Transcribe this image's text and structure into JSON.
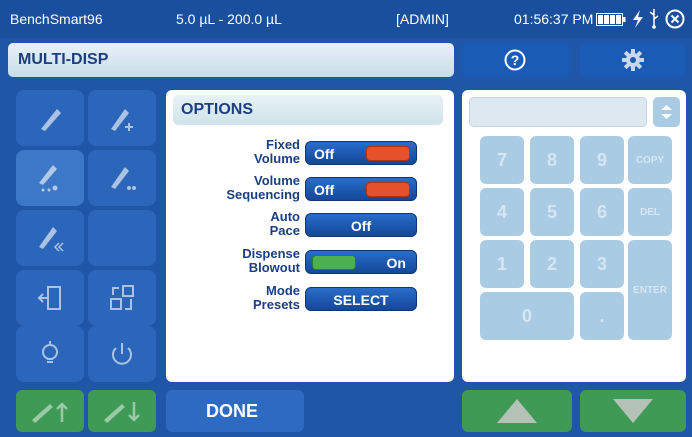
{
  "status_bar": {
    "device_name": "BenchSmart96",
    "volume_range": "5.0 µL - 200.0 µL",
    "user_role": "[ADMIN]",
    "time": "01:56:37 PM"
  },
  "title_bar": {
    "title": "MULTI-DISP",
    "help_label": "?"
  },
  "options": {
    "heading": "OPTIONS",
    "fixed_volume": {
      "label_line1": "Fixed",
      "label_line2": "Volume",
      "value": "Off"
    },
    "volume_sequencing": {
      "label_line1": "Volume",
      "label_line2": "Sequencing",
      "value": "Off"
    },
    "auto_pace": {
      "label_line1": "Auto",
      "label_line2": "Pace",
      "value": "Off"
    },
    "dispense_blowout": {
      "label_line1": "Dispense",
      "label_line2": "Blowout",
      "value": "On"
    },
    "mode_presets": {
      "label_line1": "Mode",
      "label_line2": "Presets",
      "value": "SELECT"
    }
  },
  "keypad": {
    "display_value": "",
    "keys": {
      "k7": "7",
      "k8": "8",
      "k9": "9",
      "copy": "COPY",
      "k4": "4",
      "k5": "5",
      "k6": "6",
      "del": "DEL",
      "k1": "1",
      "k2": "2",
      "k3": "3",
      "enter": "ENTER",
      "k0": "0",
      "dot": "."
    }
  },
  "bottom": {
    "done_label": "DONE"
  },
  "colors": {
    "background": "#1f56a8",
    "toggle_off_indicator": "#e5512c",
    "toggle_on_indicator": "#4caf50",
    "nav_green": "#3f9a55"
  }
}
